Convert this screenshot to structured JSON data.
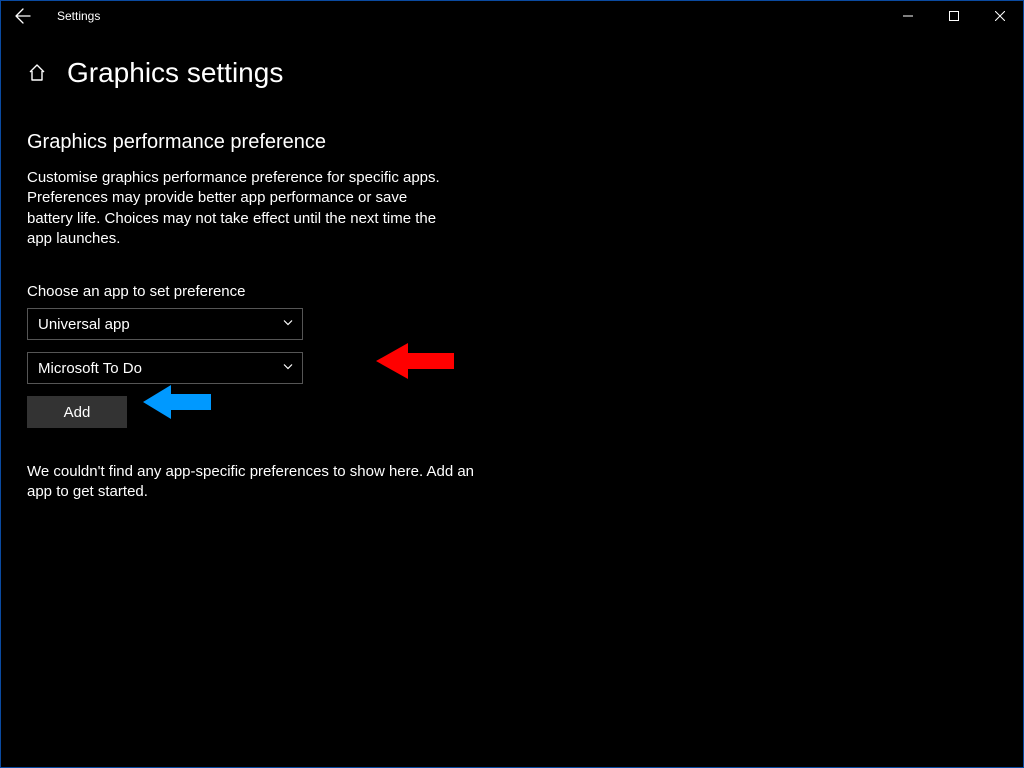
{
  "titlebar": {
    "app_name": "Settings"
  },
  "header": {
    "page_title": "Graphics settings"
  },
  "section": {
    "heading": "Graphics performance preference",
    "description": "Customise graphics performance preference for specific apps. Preferences may provide better app performance or save battery life. Choices may not take effect until the next time the app launches.",
    "choose_label": "Choose an app to set preference",
    "app_type_value": "Universal app",
    "app_select_value": "Microsoft To Do",
    "add_label": "Add",
    "empty_message": "We couldn't find any app-specific preferences to show here. Add an app to get started."
  }
}
